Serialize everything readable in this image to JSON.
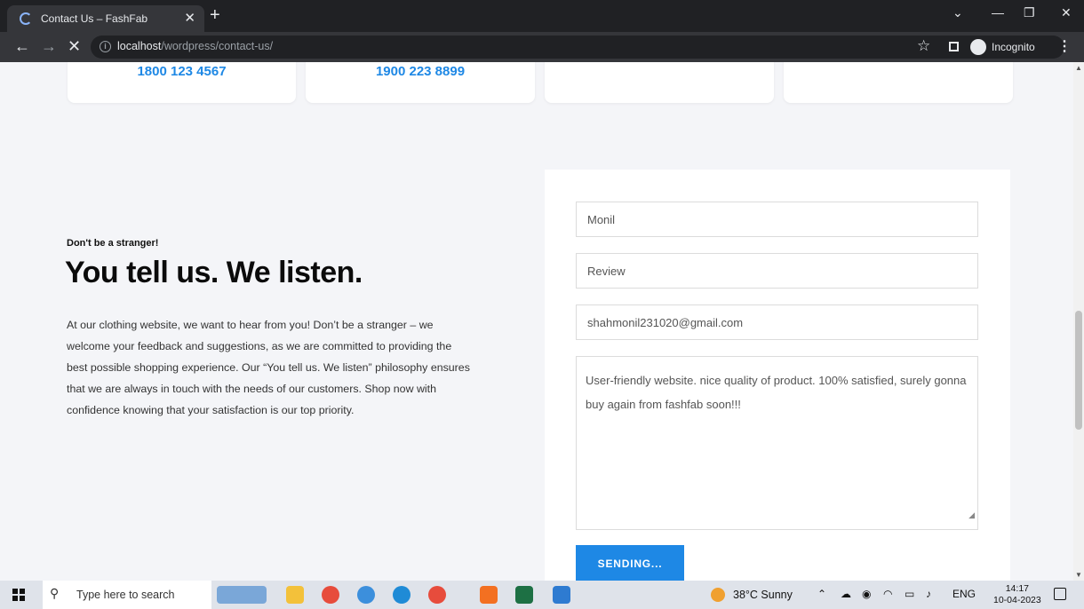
{
  "browser": {
    "tab_title": "Contact Us – FashFab",
    "url_host": "localhost",
    "url_path": "/wordpress/contact-us/",
    "incognito_label": "Incognito"
  },
  "contact_cards": [
    {
      "phone": "1800 123 4567"
    },
    {
      "phone": "1900 223 8899"
    },
    {
      "phone": ""
    },
    {
      "phone": ""
    }
  ],
  "intro": {
    "eyebrow": "Don't be a stranger!",
    "headline": "You tell us. We listen.",
    "paragraph": "At our clothing website, we want to hear from you! Don’t be a stranger – we welcome your feedback and suggestions, as we are committed to providing the best possible shopping experience. Our “You tell us. We listen” philosophy ensures that we are always in touch with the needs of our customers. Shop now with confidence knowing that your satisfaction is our top priority."
  },
  "form": {
    "name_value": "Monil",
    "subject_value": "Review",
    "email_value": "shahmonil231020@gmail.com",
    "message_value": "User-friendly website. nice quality of product. 100% satisfied, surely gonna buy again from fashfab soon!!!",
    "submit_label": "SENDING..."
  },
  "taskbar": {
    "search_placeholder": "Type here to search",
    "weather": "38°C  Sunny",
    "language": "ENG",
    "time": "14:17",
    "date": "10-04-2023"
  },
  "colors": {
    "accent": "#1e88e5",
    "page_bg": "#f4f5f8",
    "chrome_dark": "#202124"
  }
}
